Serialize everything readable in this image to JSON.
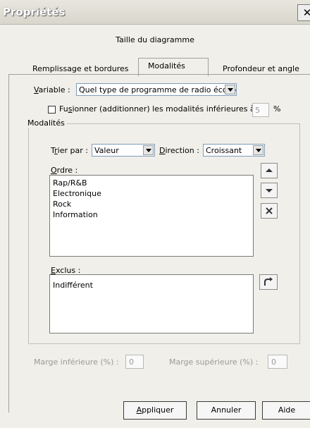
{
  "window": {
    "title": "Propriétés",
    "close_glyph": "✕"
  },
  "tabs": {
    "row1": [
      "Taille du diagramme"
    ],
    "row2": [
      "Remplissage et bordures",
      "Modalités",
      "Profondeur et angle"
    ],
    "active": "Modalités"
  },
  "variable": {
    "label": "Variable :",
    "value": "Quel type de programme de radio écoutez-..."
  },
  "merge": {
    "label": "Fusionner (additionner) les modalités inférieures à :",
    "value": "5",
    "unit": "%",
    "checked": false
  },
  "modalities_group": {
    "title": "Modalités",
    "sort_label": "Trier par :",
    "sort_value": "Valeur",
    "direction_label": "Direction :",
    "direction_value": "Croissant",
    "order_label": "Ordre :",
    "order_items": [
      "Rap/R&B",
      "Electronique",
      "Rock",
      "Information"
    ],
    "excluded_label": "Exclus :",
    "excluded_items": [
      "Indifférent"
    ]
  },
  "margins": {
    "lower_label": "Marge inférieure (%) :",
    "lower_value": "0",
    "upper_label": "Marge supérieure (%) :",
    "upper_value": "0"
  },
  "buttons": {
    "apply": "Appliquer",
    "cancel": "Annuler",
    "help": "Aide"
  },
  "icons": {
    "up": "arrow-up-icon",
    "down": "arrow-down-icon",
    "remove": "close-x-icon",
    "restore": "curved-arrow-up-icon",
    "dropdown": "chevron-down-icon"
  }
}
